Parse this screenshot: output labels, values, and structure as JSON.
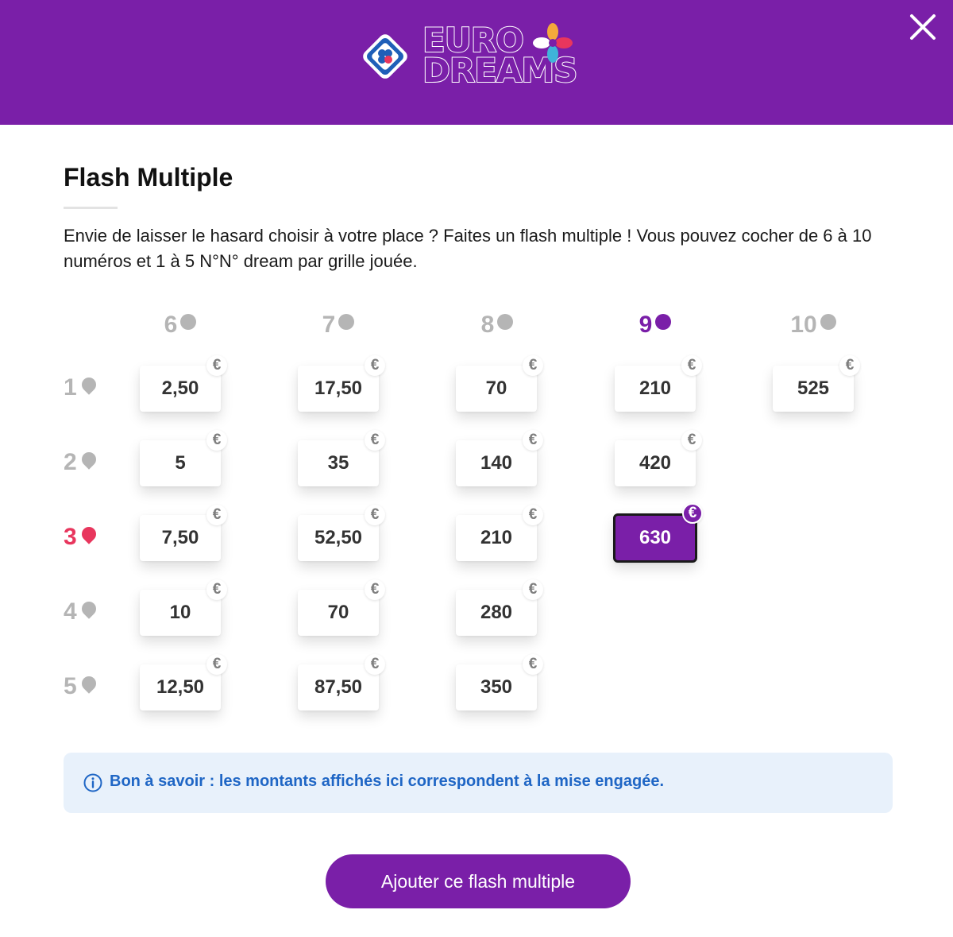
{
  "header": {
    "logo_line1": "EURO",
    "logo_line2": "DREAMS",
    "brand_color": "#7a1fa8",
    "close_icon": "close-icon"
  },
  "title": "Flash Multiple",
  "intro": "Envie de laisser le hasard choisir à votre place ? Faites un flash multiple ! Vous pouvez cocher de 6 à 10 numéros et 1 à 5 N°N° dream par grille jouée.",
  "grid": {
    "columns": [
      "6",
      "7",
      "8",
      "9",
      "10"
    ],
    "selected_column": "9",
    "rows": [
      "1",
      "2",
      "3",
      "4",
      "5"
    ],
    "selected_row": "3",
    "currency": "€",
    "values": {
      "r1": [
        "2,50",
        "17,50",
        "70",
        "210",
        "525"
      ],
      "r2": [
        "5",
        "35",
        "140",
        "420"
      ],
      "r3": [
        "7,50",
        "52,50",
        "210",
        "630"
      ],
      "r4": [
        "10",
        "70",
        "280"
      ],
      "r5": [
        "12,50",
        "87,50",
        "350"
      ]
    },
    "selected_value": "630"
  },
  "info": {
    "text": "Bon à savoir : les montants affichés ici correspondent à la mise engagée.",
    "icon": "info-icon",
    "color": "#1f66c5"
  },
  "cta_label": "Ajouter ce flash multiple"
}
